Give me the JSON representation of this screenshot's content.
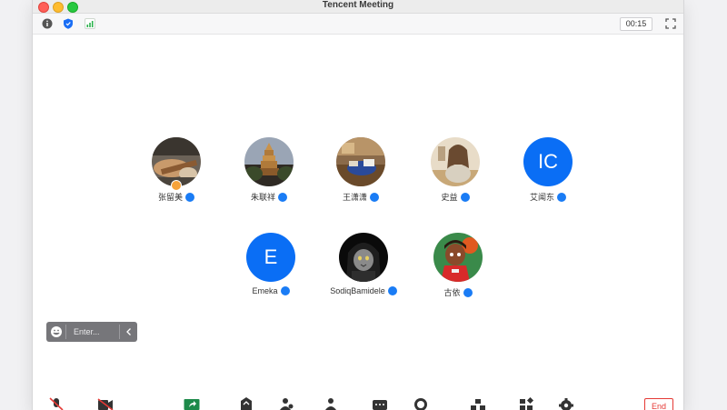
{
  "window": {
    "title": "Tencent Meeting"
  },
  "toolbar": {
    "timer": "00:15"
  },
  "participants": [
    {
      "name": "张留美",
      "avatar_type": "photo-guitar",
      "host": true
    },
    {
      "name": "朱联祥",
      "avatar_type": "photo-pagoda",
      "host": false
    },
    {
      "name": "王潇潇",
      "avatar_type": "photo-desk",
      "host": false
    },
    {
      "name": "史益",
      "avatar_type": "photo-illustration",
      "host": false
    },
    {
      "name": "艾闻东",
      "avatar_type": "initials",
      "initials": "IC",
      "host": false
    },
    {
      "name": "Emeka",
      "avatar_type": "initials",
      "initials": "E",
      "host": false
    },
    {
      "name": "SodiqBamidele",
      "avatar_type": "photo-cat-hood",
      "host": false
    },
    {
      "name": "古依",
      "avatar_type": "photo-cartoon",
      "host": false
    }
  ],
  "chat": {
    "placeholder": "Enter..."
  },
  "controls": {
    "end_label": "End"
  },
  "colors": {
    "accent": "#0a6ef5",
    "mic_blue": "#1a7cf5",
    "end_red": "#e53935",
    "host_orange": "#f7a33a"
  }
}
